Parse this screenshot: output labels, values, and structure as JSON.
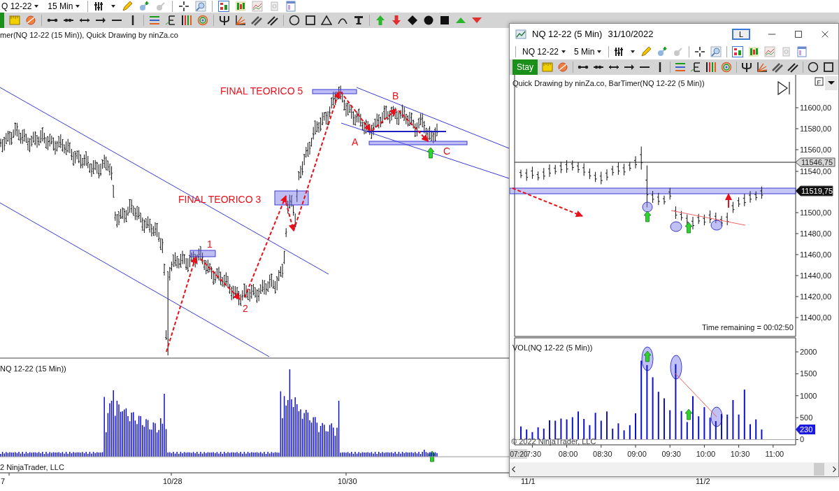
{
  "main_window": {
    "toolbar": {
      "instrument": "Q 12-22",
      "interval": "15 Min"
    },
    "indicator_label": "mer(NQ 12-22 (15 Min)), Quick Drawing by ninZa.co",
    "annotations": [
      "FINAL TEORICO 5",
      "FINAL TEORICO 3",
      "1",
      "2",
      "A",
      "B",
      "C"
    ],
    "volume_label": "NQ 12-22 (15 Min))",
    "copyright": "2 NinjaTrader, LLC",
    "date_axis": [
      "7",
      "10/28",
      "10/30",
      "11/1",
      "11/2"
    ]
  },
  "chart_window": {
    "title": "NQ 12-22 (5 Min)",
    "date": "31/10/2022",
    "layout_button": "L",
    "toolbar": {
      "instrument": "NQ 12-22",
      "interval": "5 Min",
      "stay_button": "Stay"
    },
    "indicator_label": "Quick Drawing by ninZa.co, BarTimer(NQ 12-22 (5 Min))",
    "f_button": "F",
    "price_axis": [
      "11600,00",
      "11580,00",
      "11560,00",
      "11540,00",
      "11500,00",
      "11480,00",
      "11460,00",
      "11440,00",
      "11420,00",
      "11400,00"
    ],
    "price_flags": [
      {
        "text": "11546,75",
        "kind": "last"
      },
      {
        "text": "11519,75",
        "kind": "line"
      }
    ],
    "time_remaining": "Time remaining = 00:02:50",
    "volume_label": "VOL(NQ 12-22 (5 Min))",
    "volume_flag": "230",
    "copyright": "© 2022 NinjaTrader, LLC",
    "crosshair_time": "07:20",
    "volume_chart": {
      "chart_data": {
        "type": "bar",
        "categories": [
          null,
          null,
          "7:30",
          null,
          null,
          null,
          null,
          null,
          "08:00",
          null,
          null,
          null,
          null,
          null,
          "08:30",
          null,
          null,
          null,
          null,
          null,
          "09:00",
          null,
          null,
          null,
          null,
          null,
          "09:30",
          null,
          null,
          null,
          null,
          null,
          "10:00",
          null,
          null,
          null,
          null,
          null,
          "10:30",
          null,
          null,
          null,
          null,
          null,
          "11:00"
        ],
        "values": [
          300,
          230,
          170,
          280,
          250,
          440,
          430,
          480,
          460,
          510,
          640,
          470,
          330,
          610,
          430,
          640,
          250,
          370,
          210,
          330,
          600,
          1800,
          1700,
          1420,
          1090,
          940,
          670,
          1720,
          650,
          400,
          990,
          530,
          740,
          500,
          420,
          580,
          570,
          900,
          570,
          1140,
          350,
          460,
          230,
          null,
          null
        ],
        "ylim": [
          -120,
          2320
        ],
        "yticks": [
          {
            "value": 0,
            "label": "0"
          },
          {
            "value": 500,
            "label": "500"
          },
          {
            "value": 1000,
            "label": "1000"
          },
          {
            "value": 1500,
            "label": "1500"
          },
          {
            "value": 2000,
            "label": "2000"
          }
        ]
      }
    }
  }
}
